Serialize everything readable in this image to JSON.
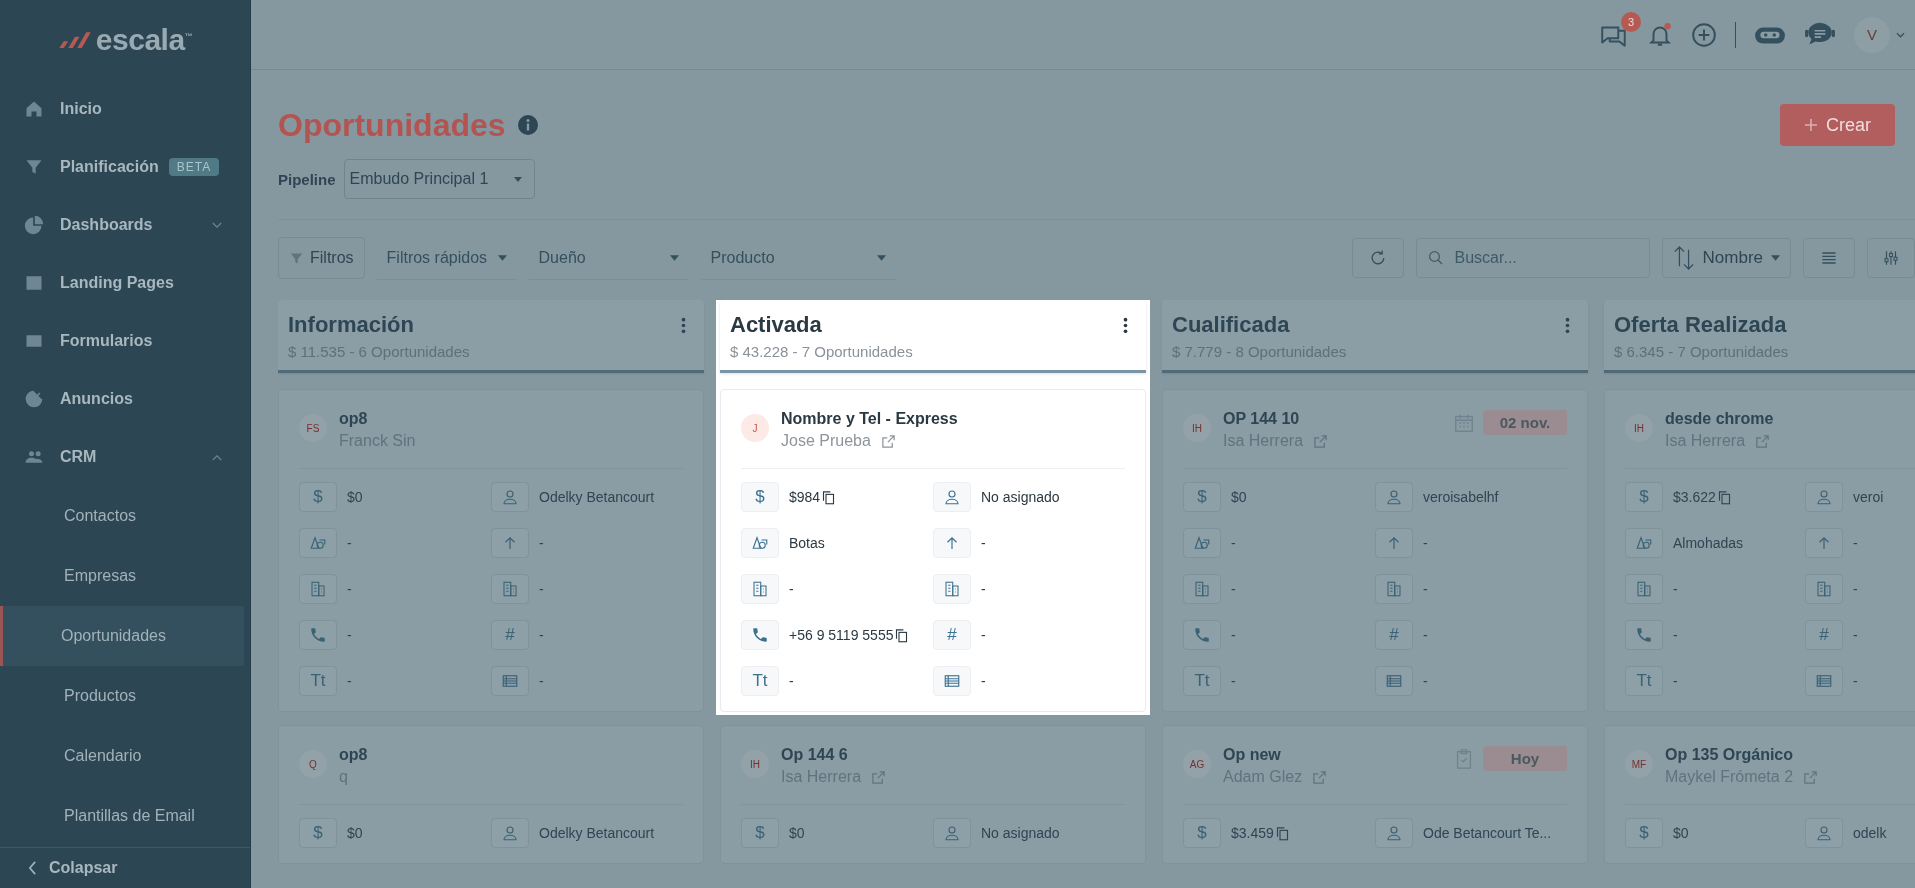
{
  "sidebar": {
    "logo": "escala$^{™}$",
    "items": [
      {
        "label": "Inicio",
        "selected": false
      },
      {
        "label": "Planificación",
        "badge": "BETA",
        "selected": false
      },
      {
        "label": "Dashboards",
        "selected": false,
        "expanded": false
      },
      {
        "label": "Landing Pages",
        "selected": false
      },
      {
        "label": "Formularios",
        "selected": false
      },
      {
        "label": "Anuncios",
        "selected": false
      },
      {
        "label": "CRM",
        "selected": false,
        "expanded": true,
        "children": [
          {
            "label": "Contactos",
            "selected": false
          },
          {
            "label": "Empresas",
            "selected": false
          },
          {
            "label": "Oportunidades",
            "selected": true
          },
          {
            "label": "Productos",
            "selected": false
          },
          {
            "label": "Calendario",
            "selected": false
          },
          {
            "label": "Plantillas de Email",
            "selected": false
          }
        ]
      }
    ],
    "collapse": "Colapsar"
  },
  "topbar": {
    "chat_badge": "3",
    "avatar": "V"
  },
  "page": {
    "title": "Oportunidades",
    "create": "Crear",
    "pipeline_label": "Pipeline",
    "pipeline": "Embudo Principal 1"
  },
  "filters": {
    "filters_button": "Filtros",
    "quick_filters": "Filtros rápidos",
    "owner": "Dueño",
    "product": "Producto",
    "search": {
      "placeholder": "Buscar..."
    },
    "sort": "Nombre"
  },
  "columns": [
    {
      "title": "Información",
      "summary": "$ 11.535 - 6 Oportunidades",
      "menu": true,
      "spotlight": false,
      "cards": [
        {
          "initials": "FS",
          "title": "op8",
          "contact": "Franck Sin",
          "link": false,
          "fields": [
            {
              "kind": "amount",
              "symbol": "$",
              "value": "$0",
              "copy": false
            },
            {
              "kind": "owner",
              "value": "Odelky Betancourt",
              "copy": false
            },
            {
              "kind": "product",
              "value": "-",
              "copy": false
            },
            {
              "kind": "stage",
              "value": "-",
              "copy": false
            },
            {
              "kind": "company",
              "value": "-",
              "copy": false
            },
            {
              "kind": "company_alt",
              "value": "-",
              "copy": false
            },
            {
              "kind": "phone",
              "value": "-",
              "copy": false
            },
            {
              "kind": "number",
              "symbol": "#",
              "value": "-",
              "copy": false
            },
            {
              "kind": "text",
              "symbol": "Tt",
              "value": "-",
              "copy": false
            },
            {
              "kind": "table",
              "value": "-",
              "copy": false
            }
          ]
        },
        {
          "initials": "Q",
          "title": "op8",
          "contact": "q",
          "link": false,
          "fields": [
            {
              "kind": "amount",
              "symbol": "$",
              "value": "$0",
              "copy": false
            },
            {
              "kind": "owner",
              "value": "Odelky Betancourt",
              "copy": false
            }
          ]
        }
      ]
    },
    {
      "title": "Activada",
      "summary": "$ 43.228 - 7 Oportunidades",
      "menu": true,
      "spotlight": true,
      "cards": [
        {
          "initials": "J",
          "title": "Nombre y Tel - Express",
          "contact": "Jose Prueba",
          "link": true,
          "fields": [
            {
              "kind": "amount",
              "symbol": "$",
              "value": "$984",
              "copy": true
            },
            {
              "kind": "owner",
              "value": "No asignado",
              "copy": false
            },
            {
              "kind": "product",
              "value": "Botas",
              "copy": false
            },
            {
              "kind": "stage",
              "value": "-",
              "copy": false
            },
            {
              "kind": "company",
              "value": "-",
              "copy": false
            },
            {
              "kind": "company_alt",
              "value": "-",
              "copy": false
            },
            {
              "kind": "phone",
              "value": "+56 9 5119 5555",
              "copy": true
            },
            {
              "kind": "number",
              "symbol": "#",
              "value": "-",
              "copy": false
            },
            {
              "kind": "text",
              "symbol": "Tt",
              "value": "-",
              "copy": false
            },
            {
              "kind": "table",
              "value": "-",
              "copy": false
            }
          ]
        },
        {
          "initials": "IH",
          "title": "Op 144 6",
          "contact": "Isa Herrera",
          "link": true,
          "fields": [
            {
              "kind": "amount",
              "symbol": "$",
              "value": "$0",
              "copy": false
            },
            {
              "kind": "owner",
              "value": "No asignado",
              "copy": false
            }
          ]
        }
      ]
    },
    {
      "title": "Cualificada",
      "summary": "$ 7.779 - 8 Oportunidades",
      "menu": true,
      "spotlight": false,
      "cards": [
        {
          "initials": "IH",
          "title": "OP 144 10",
          "contact": "Isa Herrera",
          "link": true,
          "due": {
            "kind": "calendar",
            "label": "02 nov."
          },
          "fields": [
            {
              "kind": "amount",
              "symbol": "$",
              "value": "$0",
              "copy": false
            },
            {
              "kind": "owner",
              "value": "veroisabelhf",
              "copy": false
            },
            {
              "kind": "product",
              "value": "-",
              "copy": false
            },
            {
              "kind": "stage",
              "value": "-",
              "copy": false
            },
            {
              "kind": "company",
              "value": "-",
              "copy": false
            },
            {
              "kind": "company_alt",
              "value": "-",
              "copy": false
            },
            {
              "kind": "phone",
              "value": "-",
              "copy": false
            },
            {
              "kind": "number",
              "symbol": "#",
              "value": "-",
              "copy": false
            },
            {
              "kind": "text",
              "symbol": "Tt",
              "value": "-",
              "copy": false
            },
            {
              "kind": "table",
              "value": "-",
              "copy": false
            }
          ]
        },
        {
          "initials": "AG",
          "title": "Op new",
          "contact": "Adam Glez",
          "link": true,
          "due": {
            "kind": "task",
            "label": "Hoy"
          },
          "fields": [
            {
              "kind": "amount",
              "symbol": "$",
              "value": "$3.459",
              "copy": true
            },
            {
              "kind": "owner",
              "value": "Ode Betancourt Te...",
              "copy": false
            }
          ]
        }
      ]
    },
    {
      "title": "Oferta Realizada",
      "summary": "$ 6.345 - 7 Oportunidades",
      "menu": false,
      "spotlight": false,
      "cards": [
        {
          "initials": "IH",
          "title": "desde chrome",
          "contact": "Isa Herrera",
          "link": true,
          "fields": [
            {
              "kind": "amount",
              "symbol": "$",
              "value": "$3.622",
              "copy": true
            },
            {
              "kind": "owner",
              "value": "veroi",
              "copy": false
            },
            {
              "kind": "product",
              "value": "Almohadas",
              "copy": false
            },
            {
              "kind": "stage",
              "value": "-",
              "copy": false
            },
            {
              "kind": "company",
              "value": "-",
              "copy": false
            },
            {
              "kind": "company_alt",
              "value": "-",
              "copy": false
            },
            {
              "kind": "phone",
              "value": "-",
              "copy": false
            },
            {
              "kind": "number",
              "symbol": "#",
              "value": "-",
              "copy": false
            },
            {
              "kind": "text",
              "symbol": "Tt",
              "value": "-",
              "copy": false
            },
            {
              "kind": "table",
              "value": "-",
              "copy": false
            }
          ]
        },
        {
          "initials": "MF",
          "title": "Op 135 Orgánico",
          "contact": "Maykel Frómeta 2",
          "link": true,
          "fields": [
            {
              "kind": "amount",
              "symbol": "$",
              "value": "$0",
              "copy": false
            },
            {
              "kind": "owner",
              "value": "odelk",
              "copy": false
            }
          ]
        }
      ]
    }
  ]
}
